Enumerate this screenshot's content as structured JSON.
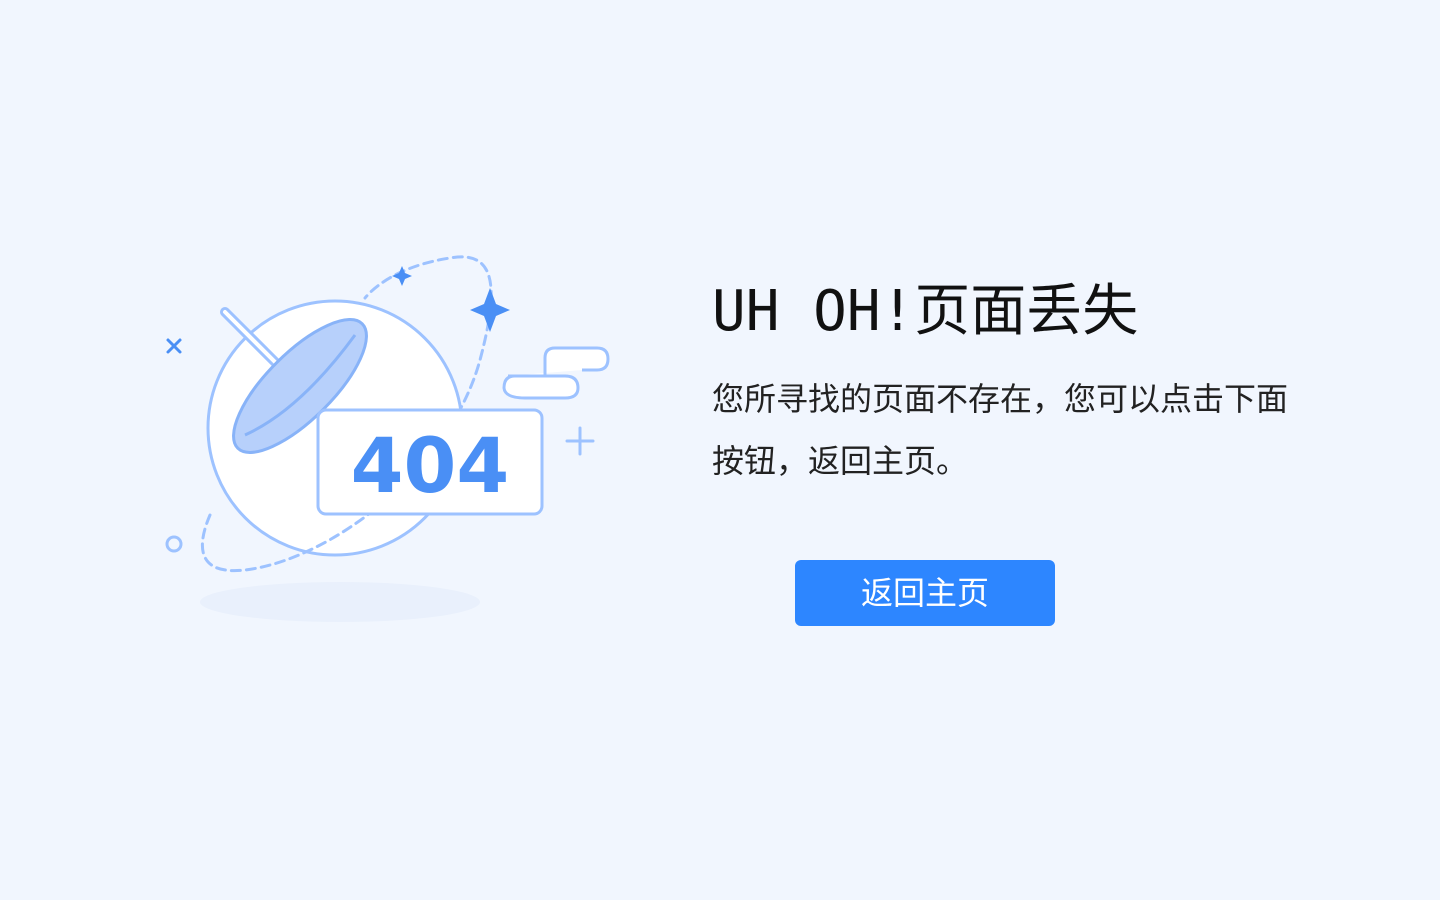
{
  "illustration": {
    "code": "404"
  },
  "error": {
    "title": "UH OH!页面丢失",
    "message": "您所寻找的页面不存在，您可以点击下面按钮，返回主页。"
  },
  "actions": {
    "home_label": "返回主页"
  },
  "colors": {
    "background": "#f1f6fe",
    "accent": "#2d86ff",
    "illustration_stroke": "#9dc2ff",
    "illustration_fill": "#4a8ff5"
  },
  "icons": [
    "satellite-dish-icon",
    "star-icon",
    "sparkle-icon",
    "cross-icon",
    "plus-icon",
    "circle-icon",
    "cloud-icon"
  ]
}
